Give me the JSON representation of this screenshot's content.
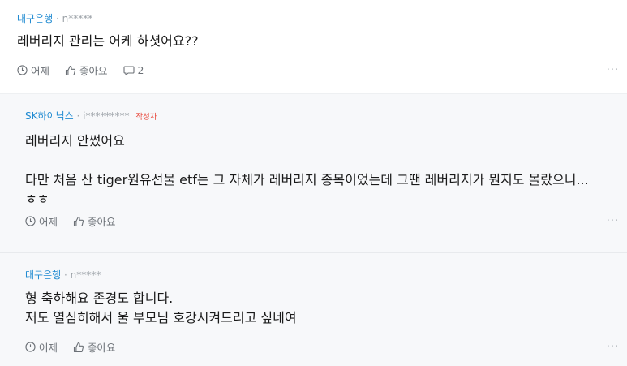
{
  "comments": [
    {
      "author": "대구은행",
      "separator": "·",
      "user_id": "n*****",
      "lines": [
        "레버리지 관리는 어케 하셧어요??"
      ],
      "time": "어제",
      "like_label": "좋아요",
      "reply_count": "2",
      "more_label": "···"
    },
    {
      "author": "SK하이닉스",
      "separator": "·",
      "user_id": "i*********",
      "writer_tag": "작성자",
      "lines": [
        "레버리지 안썼어요",
        "다만 처음 산 tiger원유선물 etf는 그 자체가 레버리지 종목이었는데 그땐 레버리지가 뭔지도 몰랐으니...",
        "ㅎㅎ"
      ],
      "time": "어제",
      "like_label": "좋아요",
      "more_label": "···"
    },
    {
      "author": "대구은행",
      "separator": "·",
      "user_id": "n*****",
      "lines": [
        "형 축하해요 존경도 합니다.",
        "저도 열심히해서 울 부모님 호강시켜드리고 싶네여"
      ],
      "time": "어제",
      "like_label": "좋아요",
      "more_label": "···"
    }
  ],
  "colors": {
    "author": "#1f8ad1",
    "writer_tag": "#e8473b",
    "reply_bg": "#f7f8fa"
  },
  "icons": {
    "time": "clock-icon",
    "like": "thumbs-up-icon",
    "reply": "speech-bubble-icon",
    "more": "more-dots-icon"
  }
}
